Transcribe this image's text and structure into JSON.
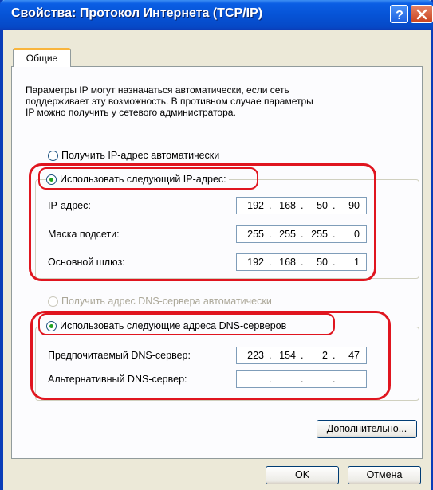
{
  "window": {
    "title": "Свойства: Протокол Интернета (TCP/IP)"
  },
  "tabs": [
    {
      "label": "Общие",
      "selected": true
    }
  ],
  "description": [
    "Параметры IP могут назначаться автоматически, если сеть",
    "поддерживает эту возможность. В противном случае параметры",
    "IP можно получить у сетевого администратора."
  ],
  "ip_mode": {
    "auto_label": "Получить IP-адрес автоматически",
    "auto_selected": false,
    "manual_label": "Использовать следующий IP-адрес:",
    "manual_selected": true
  },
  "ip_fields": [
    {
      "label": "IP-адрес:",
      "octets": [
        "192",
        "168",
        "50",
        "90"
      ]
    },
    {
      "label": "Маска подсети:",
      "octets": [
        "255",
        "255",
        "255",
        "0"
      ]
    },
    {
      "label": "Основной шлюз:",
      "octets": [
        "192",
        "168",
        "50",
        "1"
      ]
    }
  ],
  "dns_mode": {
    "auto_label": "Получить адрес DNS-сервера автоматически",
    "auto_enabled": false,
    "manual_label": "Использовать следующие адреса DNS-серверов",
    "manual_selected": true
  },
  "dns_fields": [
    {
      "label": "Предпочитаемый DNS-сервер:",
      "octets": [
        "223",
        "154",
        "2",
        "47"
      ]
    },
    {
      "label": "Альтернативный DNS-сервер:",
      "octets": [
        "",
        "",
        "",
        ""
      ]
    }
  ],
  "buttons": {
    "advanced": "Дополнительно...",
    "ok": "OK",
    "cancel": "Отмена"
  },
  "colors": {
    "annotation": "#E0151F",
    "titlebar": "#0653D6",
    "dialog_bg": "#ECE9D8",
    "radio_dot": "#21A121"
  },
  "icons": {
    "help": "question-mark-icon",
    "close": "close-x-icon"
  }
}
